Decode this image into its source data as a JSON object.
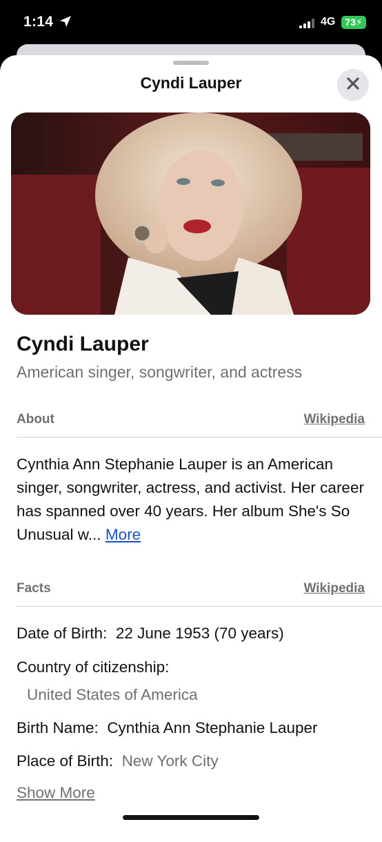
{
  "status_bar": {
    "time": "1:14",
    "network": "4G",
    "battery": "73"
  },
  "sheet": {
    "title": "Cyndi Lauper",
    "close_icon": "close-icon"
  },
  "hero": {
    "image_icon": "portrait-photo"
  },
  "entity": {
    "name": "Cyndi Lauper",
    "description": "American singer, songwriter, and actress"
  },
  "about": {
    "label": "About",
    "source": "Wikipedia",
    "text": "Cynthia Ann Stephanie Lauper is an American singer, songwriter, actress, and activist. Her career has spanned over 40 years. Her album She's So Unusual w...",
    "more": "More"
  },
  "facts": {
    "label": "Facts",
    "source": "Wikipedia",
    "items": [
      {
        "key": "Date of Birth:",
        "value": "22 June 1953 (70 years)"
      },
      {
        "key": "Country of citizenship:",
        "value": "United States of America"
      },
      {
        "key": "Birth Name:",
        "value": "Cynthia Ann Stephanie Lauper"
      },
      {
        "key": "Place of Birth:",
        "value": "New York City"
      }
    ],
    "show_more": "Show More"
  },
  "colors": {
    "accent_link": "#1a4fd0",
    "battery": "#34c759"
  }
}
